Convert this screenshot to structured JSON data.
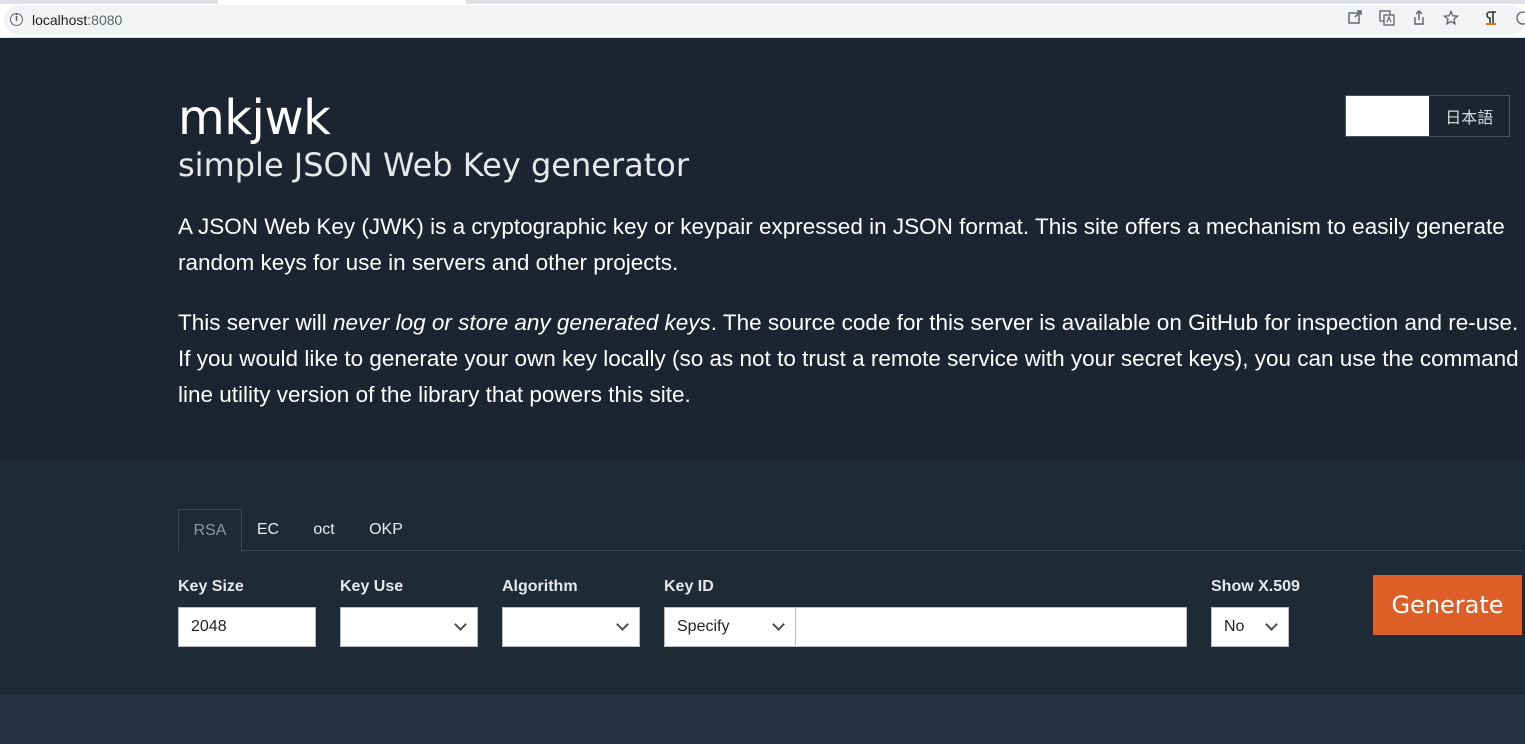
{
  "browser": {
    "url_host": "localhost",
    "url_port": ":8080"
  },
  "header": {
    "title": "mkjwk",
    "subtitle": "simple JSON Web Key generator",
    "lang_en_label": "",
    "lang_ja_label": "日本語",
    "intro_paragraph": "A JSON Web Key (JWK) is a cryptographic key or keypair expressed in JSON format. This site offers a mechanism to easily generate random keys for use in servers and other projects.",
    "privacy_before": "This server will ",
    "privacy_emphasis": "never log or store any generated keys",
    "privacy_after": ". The source code for this server is available on GitHub for inspection and re-use. If you would like to generate your own key locally (so as not to trust a remote service with your secret keys), you can use the command line utility version of the library that powers this site."
  },
  "tabs": [
    {
      "label": "RSA",
      "active": true
    },
    {
      "label": "EC",
      "active": false
    },
    {
      "label": "oct",
      "active": false
    },
    {
      "label": "OKP",
      "active": false
    }
  ],
  "form": {
    "key_size_label": "Key Size",
    "key_size_value": "2048",
    "key_use_label": "Key Use",
    "key_use_value": "",
    "algorithm_label": "Algorithm",
    "algorithm_value": "",
    "key_id_label": "Key ID",
    "key_id_mode": "Specify",
    "key_id_value": "",
    "show_x509_label": "Show X.509",
    "show_x509_value": "No",
    "generate_label": "Generate"
  },
  "colors": {
    "background": "#1b2430",
    "form_background": "#1e2a36",
    "accent": "#dd5e27"
  }
}
